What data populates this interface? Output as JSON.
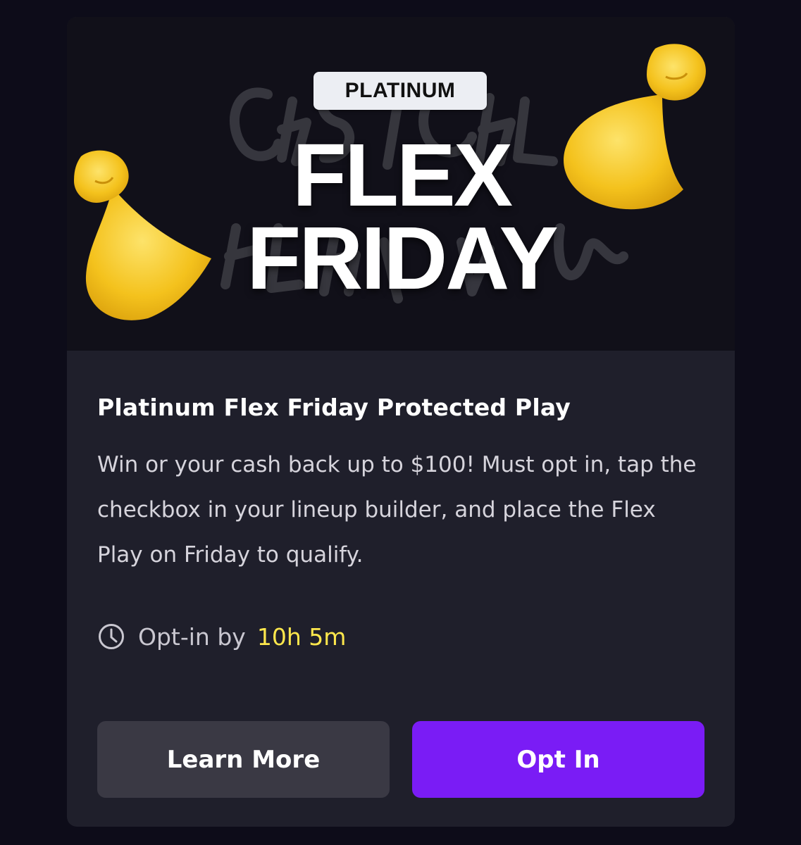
{
  "banner": {
    "badge": "PLATINUM",
    "headline_line1": "FLEX",
    "headline_line2": "FRIDAY"
  },
  "promo": {
    "title": "Platinum Flex Friday Protected Play",
    "description": "Win or your cash back up to $100! Must opt in, tap the checkbox in your lineup builder, and place the Flex Play on Friday to qualify.",
    "optin_label": "Opt-in by",
    "optin_time": "10h 5m"
  },
  "buttons": {
    "learn_more": "Learn More",
    "opt_in": "Opt In"
  },
  "colors": {
    "background": "#0d0c19",
    "card": "#1f1f2b",
    "accent_purple": "#7a1cf5",
    "timer_yellow": "#fde74c",
    "secondary_button": "#3a3944"
  },
  "icons": {
    "clock": "clock-icon",
    "left_arm": "flexed-biceps-icon",
    "right_arm": "flexed-biceps-icon"
  }
}
